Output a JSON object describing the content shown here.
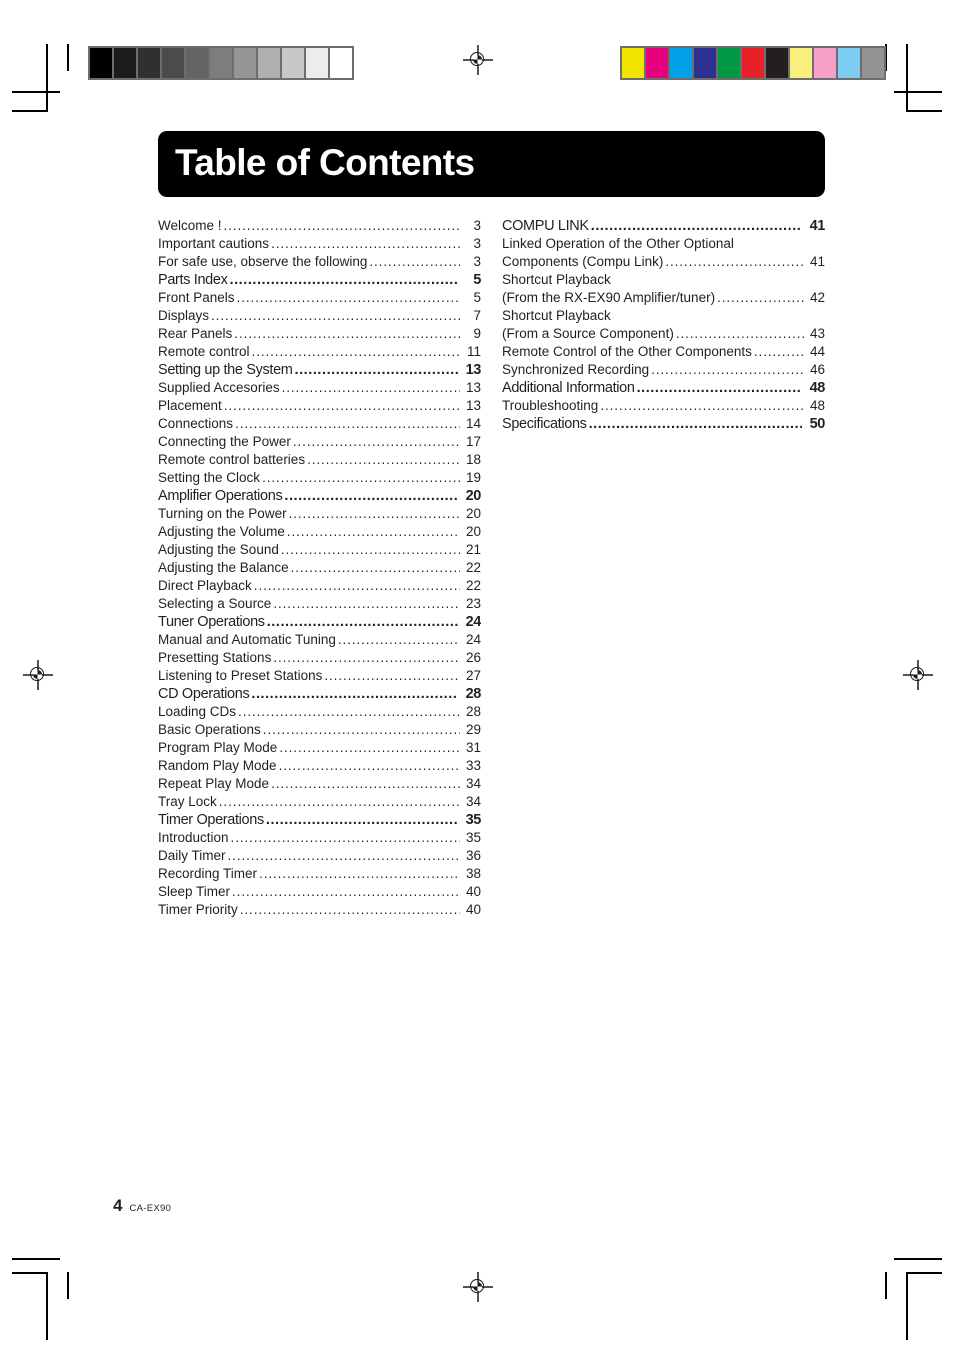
{
  "header": {
    "title": "Table of Contents"
  },
  "footer": {
    "page_number": "4",
    "model": "CA-EX90"
  },
  "calibration": {
    "grayscale_swatches": [
      "#000000",
      "#1c1c1c",
      "#303030",
      "#4b4b4b",
      "#646464",
      "#7e7e7e",
      "#969696",
      "#b0b0b0",
      "#c8c8c8",
      "#ececec",
      "#ffffff"
    ],
    "color_swatches": [
      "#f2e500",
      "#e5007d",
      "#00a0e9",
      "#2e3192",
      "#009844",
      "#e62129",
      "#231f20",
      "#faee7d",
      "#f4a0c8",
      "#7ecef4",
      "#949494"
    ]
  },
  "toc": {
    "left_column": [
      {
        "label": "Welcome !",
        "page": "3",
        "type": "entry"
      },
      {
        "label": "Important cautions",
        "page": "3",
        "type": "entry"
      },
      {
        "label": "For safe use, observe the following",
        "page": "3",
        "type": "entry"
      },
      {
        "label": "Parts Index",
        "page": "5",
        "type": "section"
      },
      {
        "label": "Front Panels",
        "page": "5",
        "type": "entry"
      },
      {
        "label": "Displays",
        "page": "7",
        "type": "entry"
      },
      {
        "label": "Rear Panels",
        "page": "9",
        "type": "entry"
      },
      {
        "label": "Remote control",
        "page": "11",
        "type": "entry"
      },
      {
        "label": "Setting up the System",
        "page": "13",
        "type": "section"
      },
      {
        "label": "Supplied Accesories",
        "page": "13",
        "type": "entry"
      },
      {
        "label": "Placement",
        "page": "13",
        "type": "entry"
      },
      {
        "label": "Connections",
        "page": "14",
        "type": "entry"
      },
      {
        "label": "Connecting the Power",
        "page": "17",
        "type": "entry"
      },
      {
        "label": "Remote control batteries",
        "page": "18",
        "type": "entry"
      },
      {
        "label": "Setting the Clock",
        "page": "19",
        "type": "entry"
      },
      {
        "label": "Amplifier Operations",
        "page": "20",
        "type": "section"
      },
      {
        "label": "Turning on the Power",
        "page": "20",
        "type": "entry"
      },
      {
        "label": "Adjusting the Volume",
        "page": "20",
        "type": "entry"
      },
      {
        "label": "Adjusting the Sound",
        "page": "21",
        "type": "entry"
      },
      {
        "label": "Adjusting the Balance",
        "page": "22",
        "type": "entry"
      },
      {
        "label": "Direct Playback",
        "page": "22",
        "type": "entry"
      },
      {
        "label": "Selecting a Source",
        "page": "23",
        "type": "entry"
      },
      {
        "label": "Tuner Operations",
        "page": "24",
        "type": "section"
      },
      {
        "label": "Manual and Automatic Tuning",
        "page": "24",
        "type": "entry"
      },
      {
        "label": "Presetting Stations",
        "page": "26",
        "type": "entry"
      },
      {
        "label": "Listening to Preset Stations",
        "page": "27",
        "type": "entry"
      },
      {
        "label": "CD Operations",
        "page": "28",
        "type": "section"
      },
      {
        "label": "Loading CDs",
        "page": "28",
        "type": "entry"
      },
      {
        "label": "Basic Operations",
        "page": "29",
        "type": "entry"
      },
      {
        "label": "Program Play Mode",
        "page": "31",
        "type": "entry"
      },
      {
        "label": "Random Play Mode",
        "page": "33",
        "type": "entry"
      },
      {
        "label": "Repeat Play Mode",
        "page": "34",
        "type": "entry"
      },
      {
        "label": "Tray Lock",
        "page": "34",
        "type": "entry"
      },
      {
        "label": "Timer Operations",
        "page": "35",
        "type": "section"
      },
      {
        "label": "Introduction",
        "page": "35",
        "type": "entry"
      },
      {
        "label": "Daily Timer",
        "page": "36",
        "type": "entry"
      },
      {
        "label": "Recording Timer",
        "page": "38",
        "type": "entry"
      },
      {
        "label": "Sleep Timer",
        "page": "40",
        "type": "entry"
      },
      {
        "label": "Timer Priority",
        "page": "40",
        "type": "entry"
      }
    ],
    "right_column": [
      {
        "label": "COMPU LINK",
        "page": "41",
        "type": "section"
      },
      {
        "label": "Linked Operation of the Other Optional",
        "page": "",
        "type": "plain"
      },
      {
        "label": "Components (Compu Link)",
        "page": "41",
        "type": "entry"
      },
      {
        "label": "Shortcut Playback",
        "page": "",
        "type": "plain"
      },
      {
        "label": "(From the RX-EX90 Amplifier/tuner)",
        "page": "42",
        "type": "entry"
      },
      {
        "label": "Shortcut Playback",
        "page": "",
        "type": "plain"
      },
      {
        "label": "(From a Source Component)",
        "page": "43",
        "type": "entry"
      },
      {
        "label": "Remote Control of the Other Components",
        "page": "44",
        "type": "entry"
      },
      {
        "label": "Synchronized Recording",
        "page": "46",
        "type": "entry"
      },
      {
        "label": "Additional Information",
        "page": "48",
        "type": "section"
      },
      {
        "label": "Troubleshooting",
        "page": "48",
        "type": "entry"
      },
      {
        "label": "Specifications",
        "page": "50",
        "type": "section"
      }
    ]
  }
}
